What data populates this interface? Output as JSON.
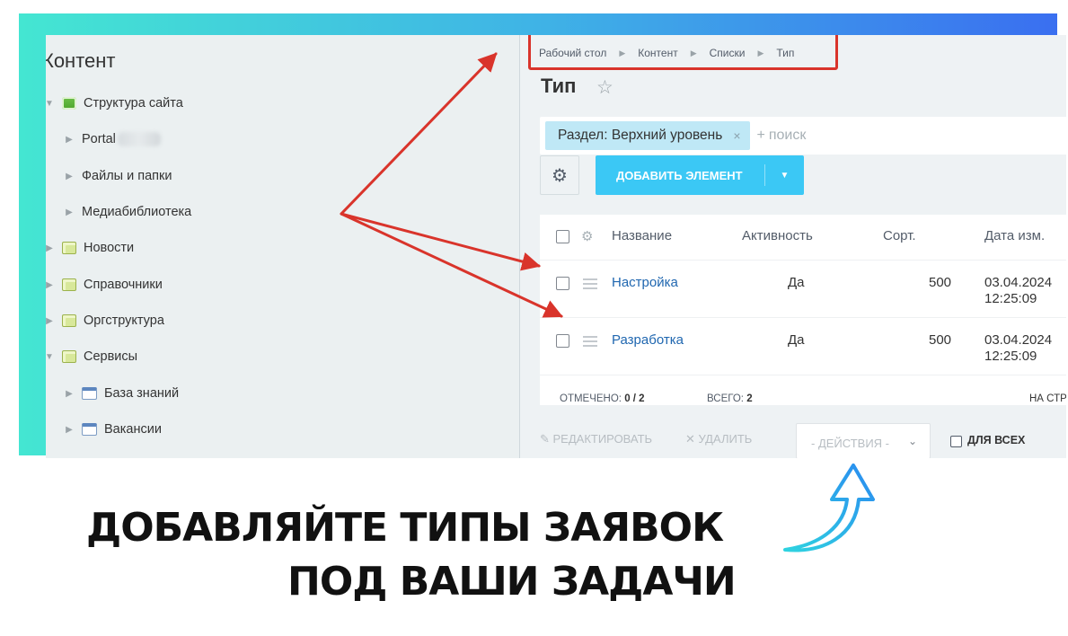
{
  "sidebar": {
    "title": "Контент",
    "items": [
      {
        "label": "Структура сайта",
        "arrow": "▼",
        "icon": "site-structure-icon"
      },
      {
        "label": "Portal",
        "arrow": "▶"
      },
      {
        "label": "Файлы и папки",
        "arrow": "▶"
      },
      {
        "label": "Медиабиблиотека",
        "arrow": "▶"
      },
      {
        "label": "Новости",
        "arrow": "▶",
        "icon": "folder-icon"
      },
      {
        "label": "Справочники",
        "arrow": "▶",
        "icon": "folder-icon"
      },
      {
        "label": "Оргструктура",
        "arrow": "▶",
        "icon": "folder-icon"
      },
      {
        "label": "Сервисы",
        "arrow": "▼",
        "icon": "folder-icon"
      },
      {
        "label": "База знаний",
        "arrow": "▶",
        "icon": "list-icon"
      },
      {
        "label": "Вакансии",
        "arrow": "▶",
        "icon": "list-icon"
      }
    ]
  },
  "breadcrumb": [
    "Рабочий стол",
    "Контент",
    "Списки",
    "Тип"
  ],
  "page": {
    "title": "Тип"
  },
  "filter": {
    "chip_label": "Раздел: Верхний уровень",
    "chip_close": "×",
    "plus": "+",
    "search_placeholder": "поиск"
  },
  "toolbar": {
    "settings_icon": "⚙",
    "add_label": "ДОБАВИТЬ ЭЛЕМЕНТ",
    "caret": "▼"
  },
  "table": {
    "columns": [
      "Название",
      "Активность",
      "Сорт.",
      "Дата изм."
    ],
    "rows": [
      {
        "name": "Настройка",
        "active": "Да",
        "sort": "500",
        "date": "03.04.2024",
        "time": "12:25:09"
      },
      {
        "name": "Разработка",
        "active": "Да",
        "sort": "500",
        "date": "03.04.2024",
        "time": "12:25:09"
      }
    ],
    "footer": {
      "selected_label": "ОТМЕЧЕНО:",
      "selected_value": "0 / 2",
      "total_label": "ВСЕГО:",
      "total_value": "2",
      "per_page_label": "НА СТР"
    }
  },
  "actions": {
    "edit": "✎ РЕДАКТИРОВАТЬ",
    "delete": "✕ УДАЛИТЬ",
    "select": "- ДЕЙСТВИЯ -",
    "for_all": "ДЛЯ ВСЕХ"
  },
  "caption": {
    "line1": "ДОБАВЛЯЙТЕ ТИПЫ ЗАЯВОК",
    "line2": "ПОД ВАШИ ЗАДАЧИ"
  },
  "colors": {
    "accent": "#3bc8f5",
    "annotation": "#d9342b",
    "frame_start": "#44e6d2",
    "frame_end": "#3a6ff0"
  }
}
